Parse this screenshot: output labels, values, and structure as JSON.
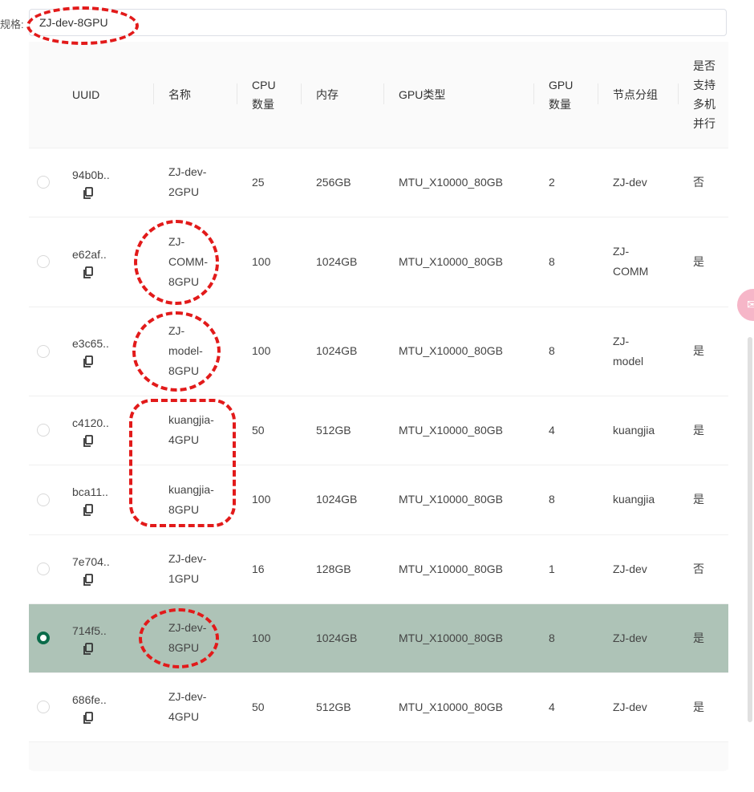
{
  "filter": {
    "label": "规格:",
    "value": "ZJ-dev-8GPU"
  },
  "table": {
    "headers": {
      "uuid": "UUID",
      "name": "名称",
      "cpu": "CPU\n数量",
      "memory": "内存",
      "gpu_type": "GPU类型",
      "gpu_count": "GPU\n数量",
      "node_group": "节点分组",
      "multi_machine": "是否\n支持\n多机\n并行"
    },
    "rows": [
      {
        "uuid": "94b0b..",
        "name": "ZJ-dev-\n2GPU",
        "cpu": "25",
        "memory": "256GB",
        "gpu_type": "MTU_X10000_80GB",
        "gpu_count": "2",
        "node_group": "ZJ-dev",
        "multi": "否",
        "selected": false
      },
      {
        "uuid": "e62af..",
        "name": "ZJ-\nCOMM-\n8GPU",
        "cpu": "100",
        "memory": "1024GB",
        "gpu_type": "MTU_X10000_80GB",
        "gpu_count": "8",
        "node_group": "ZJ-\nCOMM",
        "multi": "是",
        "selected": false
      },
      {
        "uuid": "e3c65..",
        "name": "ZJ-\nmodel-\n8GPU",
        "cpu": "100",
        "memory": "1024GB",
        "gpu_type": "MTU_X10000_80GB",
        "gpu_count": "8",
        "node_group": "ZJ-\nmodel",
        "multi": "是",
        "selected": false
      },
      {
        "uuid": "c4120..",
        "name": "kuangjia-\n4GPU",
        "cpu": "50",
        "memory": "512GB",
        "gpu_type": "MTU_X10000_80GB",
        "gpu_count": "4",
        "node_group": "kuangjia",
        "multi": "是",
        "selected": false
      },
      {
        "uuid": "bca11..",
        "name": "kuangjia-\n8GPU",
        "cpu": "100",
        "memory": "1024GB",
        "gpu_type": "MTU_X10000_80GB",
        "gpu_count": "8",
        "node_group": "kuangjia",
        "multi": "是",
        "selected": false
      },
      {
        "uuid": "7e704..",
        "name": "ZJ-dev-\n1GPU",
        "cpu": "16",
        "memory": "128GB",
        "gpu_type": "MTU_X10000_80GB",
        "gpu_count": "1",
        "node_group": "ZJ-dev",
        "multi": "否",
        "selected": false
      },
      {
        "uuid": "714f5..",
        "name": "ZJ-dev-\n8GPU",
        "cpu": "100",
        "memory": "1024GB",
        "gpu_type": "MTU_X10000_80GB",
        "gpu_count": "8",
        "node_group": "ZJ-dev",
        "multi": "是",
        "selected": true
      },
      {
        "uuid": "686fe..",
        "name": "ZJ-dev-\n4GPU",
        "cpu": "50",
        "memory": "512GB",
        "gpu_type": "MTU_X10000_80GB",
        "gpu_count": "4",
        "node_group": "ZJ-dev",
        "multi": "是",
        "selected": false
      }
    ]
  },
  "icons": {
    "copy": "copy-icon",
    "float": "chat-icon"
  },
  "colors": {
    "selected_row": "#aec3b7",
    "radio_checked": "#0b6b4a",
    "annotation": "#e21a1a"
  }
}
